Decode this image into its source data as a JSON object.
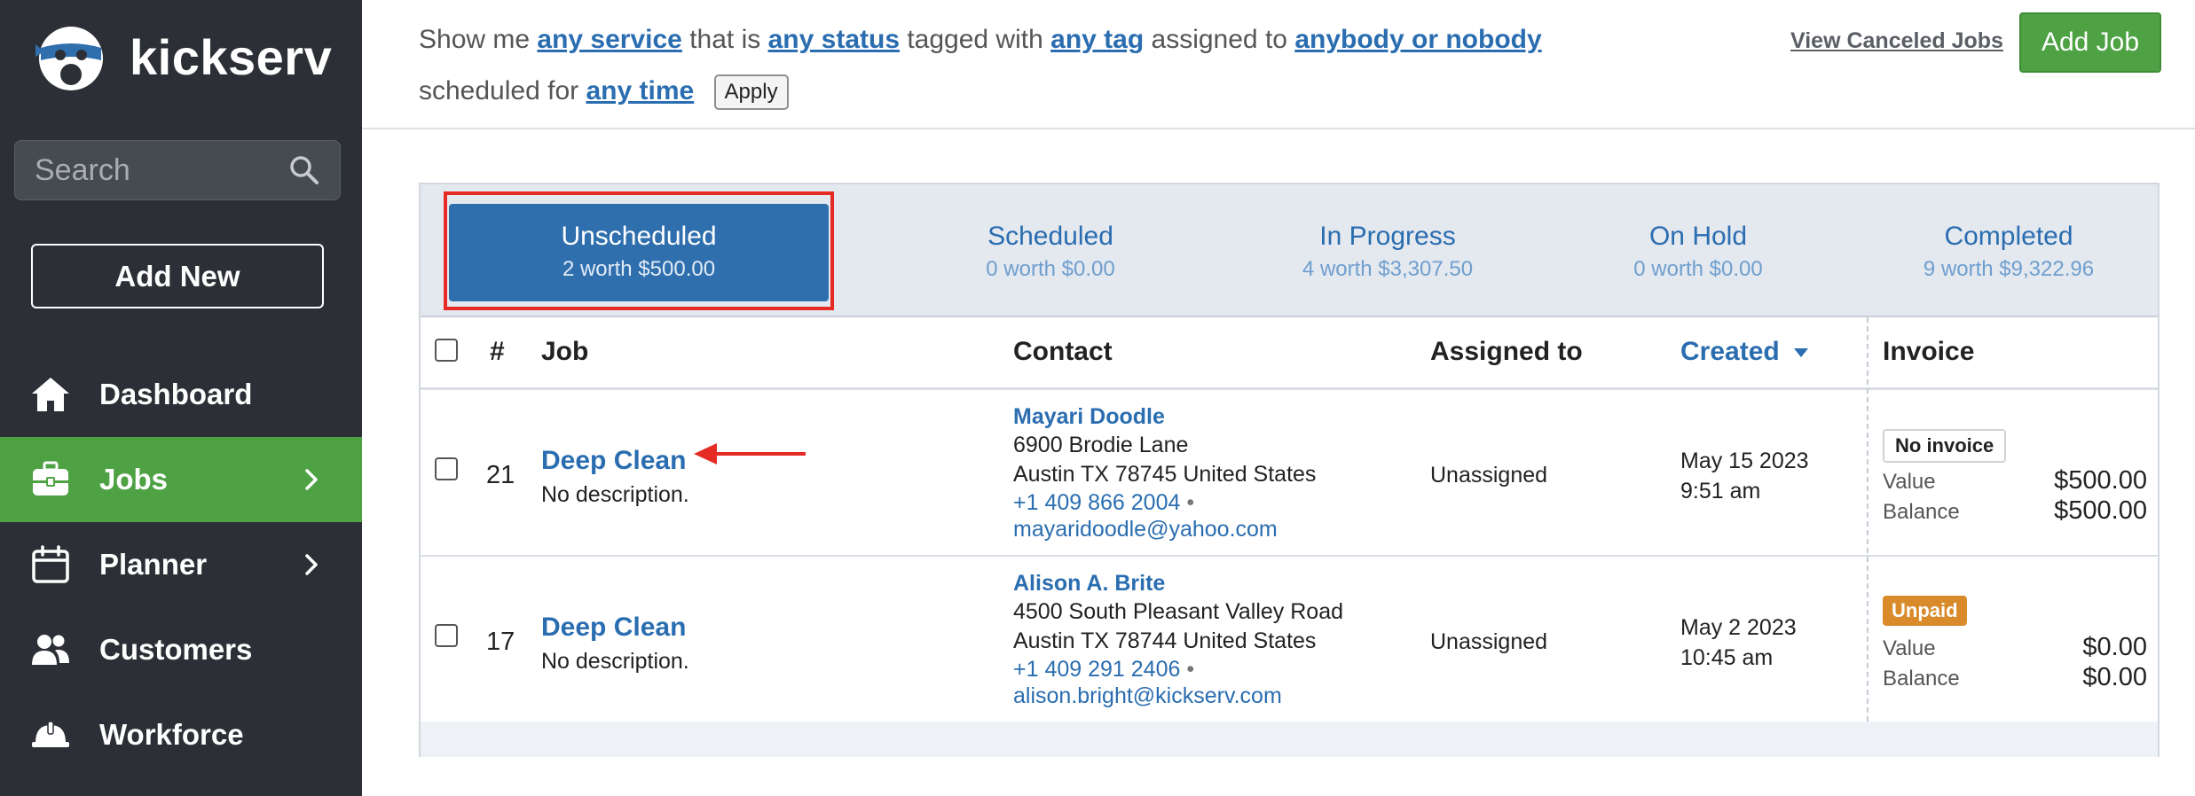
{
  "app": {
    "name": "kickserv"
  },
  "sidebar": {
    "search_placeholder": "Search",
    "add_new_label": "Add New",
    "items": [
      {
        "label": "Dashboard",
        "icon": "home-icon",
        "active": false,
        "has_chevron": false
      },
      {
        "label": "Jobs",
        "icon": "briefcase-icon",
        "active": true,
        "has_chevron": true
      },
      {
        "label": "Planner",
        "icon": "calendar-icon",
        "active": false,
        "has_chevron": true
      },
      {
        "label": "Customers",
        "icon": "people-icon",
        "active": false,
        "has_chevron": false
      },
      {
        "label": "Workforce",
        "icon": "hardhat-icon",
        "active": false,
        "has_chevron": false
      }
    ]
  },
  "filter": {
    "show_me": "Show me",
    "service": "any service",
    "that_is": "that is",
    "status": "any status",
    "tagged_with": "tagged with",
    "tag": "any tag",
    "assigned_to": "assigned to",
    "assignee": "anybody or nobody",
    "scheduled_for": "scheduled for",
    "time": "any time",
    "apply_label": "Apply"
  },
  "actions": {
    "view_canceled_label": "View Canceled Jobs",
    "add_job_label": "Add Job"
  },
  "tabs": [
    {
      "label": "Unscheduled",
      "sub": "2 worth $500.00",
      "active": true
    },
    {
      "label": "Scheduled",
      "sub": "0 worth $0.00",
      "active": false
    },
    {
      "label": "In Progress",
      "sub": "4 worth $3,307.50",
      "active": false
    },
    {
      "label": "On Hold",
      "sub": "0 worth $0.00",
      "active": false
    },
    {
      "label": "Completed",
      "sub": "9 worth $9,322.96",
      "active": false
    }
  ],
  "table": {
    "headers": {
      "number": "#",
      "job": "Job",
      "contact": "Contact",
      "assigned": "Assigned to",
      "created": "Created",
      "invoice": "Invoice"
    },
    "rows": [
      {
        "number": "21",
        "job_title": "Deep Clean",
        "job_desc": "No description.",
        "contact_name": "Mayari Doodle",
        "address1": "6900 Brodie Lane",
        "address2": "Austin TX 78745 United States",
        "phone": "+1 409 866 2004",
        "sep": "•",
        "email": "mayaridoodle@yahoo.com",
        "assigned": "Unassigned",
        "created_date": "May 15 2023",
        "created_time": "9:51 am",
        "invoice_badge": "No invoice",
        "value_label": "Value",
        "value": "$500.00",
        "balance_label": "Balance",
        "balance": "$500.00"
      },
      {
        "number": "17",
        "job_title": "Deep Clean",
        "job_desc": "No description.",
        "contact_name": "Alison A. Brite",
        "address1": "4500 South Pleasant Valley Road",
        "address2": "Austin TX 78744 United States",
        "phone": "+1 409 291 2406",
        "sep": "•",
        "email": "alison.bright@kickserv.com",
        "assigned": "Unassigned",
        "created_date": "May 2 2023",
        "created_time": "10:45 am",
        "invoice_badge": "Unpaid",
        "value_label": "Value",
        "value": "$0.00",
        "balance_label": "Balance",
        "balance": "$0.00"
      }
    ]
  },
  "colors": {
    "sidebar_bg": "#2c3036",
    "active_green": "#4ea244",
    "link_blue": "#2a6db0",
    "tab_active_bg": "#2f6fae",
    "highlight_red": "#e52b23",
    "unpaid_orange": "#d98a2b"
  }
}
